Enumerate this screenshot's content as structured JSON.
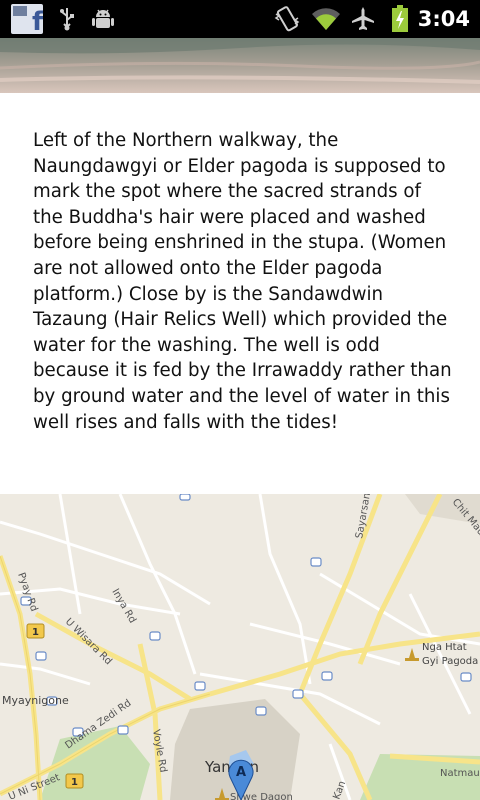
{
  "status_bar": {
    "time": "3:04",
    "icons": [
      "facebook-notification-icon",
      "usb-icon",
      "android-debug-icon",
      "vibrate-icon",
      "wifi-icon",
      "airplane-mode-icon",
      "battery-charging-icon"
    ],
    "facebook_glyph": "f"
  },
  "article": {
    "paragraph": "Left of the Northern walkway, the Naungdawgyi or Elder pagoda is supposed to mark the spot where the sacred strands of the Buddha's hair were placed and washed before being enshrined in the stupa. (Women are not allowed onto the Elder pagoda platform.) Close by is the Sandawdwin Tazaung (Hair Relics Well) which provided the water for the washing. The well is odd because it is fed by the Irrawaddy rather than by ground water and the level of water in this well rises and falls with the tides!"
  },
  "map": {
    "labels": {
      "pyay_rd": "Pyay Rd",
      "inya_rd": "Inya Rd",
      "u_wisara_rd": "U Wisara Rd",
      "dhama_zedi_rd": "Dhama Zedi Rd",
      "voyle_rd": "Voyle Rd",
      "myaynigone": "Myaynigone",
      "u_ni_street": "U Ni Street",
      "sayarsan": "Sayarsan",
      "chit_maung": "Chit Mau",
      "nga_htat_line1": "Nga Htat",
      "nga_htat_line2": "Gyi Pagoda",
      "natmauk": "Natmau",
      "yangon": "Yangon",
      "shwe_dagon": "Shwe Dagon",
      "route_1": "1",
      "marker_letter": "A",
      "road_kan": "Kan"
    },
    "colors": {
      "background": "#eeeae1",
      "major_road": "#f7e489",
      "minor_road": "#ffffff",
      "park": "#c8dfb3",
      "water": "#a6c8ee",
      "marker": "#4a8ad8"
    }
  }
}
